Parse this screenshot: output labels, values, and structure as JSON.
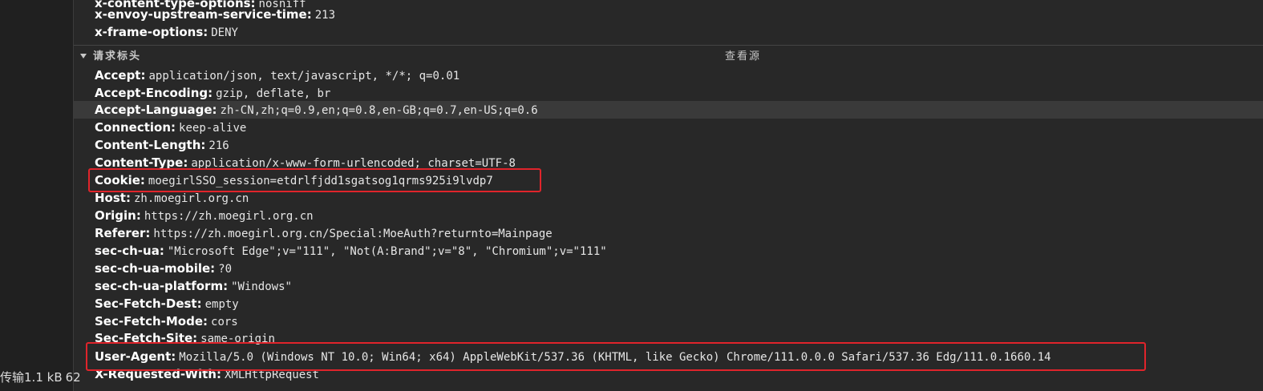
{
  "left_panel": {
    "status_label": "传输",
    "status_size": "1.1 kB",
    "status_trail": "62"
  },
  "response_headers_partial": [
    {
      "key": "x-content-type-options:",
      "value": "nosniff"
    },
    {
      "key": "x-envoy-upstream-service-time:",
      "value": "213"
    },
    {
      "key": "x-frame-options:",
      "value": "DENY"
    }
  ],
  "request_headers": {
    "title": "请求标头",
    "view_source": "查看源",
    "items": [
      {
        "key": "Accept:",
        "value": "application/json, text/javascript, */*; q=0.01"
      },
      {
        "key": "Accept-Encoding:",
        "value": "gzip, deflate, br"
      },
      {
        "key": "Accept-Language:",
        "value": "zh-CN,zh;q=0.9,en;q=0.8,en-GB;q=0.7,en-US;q=0.6"
      },
      {
        "key": "Connection:",
        "value": "keep-alive"
      },
      {
        "key": "Content-Length:",
        "value": "216"
      },
      {
        "key": "Content-Type:",
        "value": "application/x-www-form-urlencoded; charset=UTF-8"
      },
      {
        "key": "Cookie:",
        "value": "moegirlSSO_session=etdrlfjdd1sgatsog1qrms925i9lvdp7"
      },
      {
        "key": "Host:",
        "value": "zh.moegirl.org.cn"
      },
      {
        "key": "Origin:",
        "value": "https://zh.moegirl.org.cn"
      },
      {
        "key": "Referer:",
        "value": "https://zh.moegirl.org.cn/Special:MoeAuth?returnto=Mainpage"
      },
      {
        "key": "sec-ch-ua:",
        "value": "\"Microsoft Edge\";v=\"111\", \"Not(A:Brand\";v=\"8\", \"Chromium\";v=\"111\""
      },
      {
        "key": "sec-ch-ua-mobile:",
        "value": "?0"
      },
      {
        "key": "sec-ch-ua-platform:",
        "value": "\"Windows\""
      },
      {
        "key": "Sec-Fetch-Dest:",
        "value": "empty"
      },
      {
        "key": "Sec-Fetch-Mode:",
        "value": "cors"
      },
      {
        "key": "Sec-Fetch-Site:",
        "value": "same-origin"
      },
      {
        "key": "User-Agent:",
        "value": "Mozilla/5.0 (Windows NT 10.0; Win64; x64) AppleWebKit/537.36 (KHTML, like Gecko) Chrome/111.0.0.0 Safari/537.36 Edg/111.0.1660.14"
      },
      {
        "key": "X-Requested-With:",
        "value": "XMLHttpRequest"
      }
    ]
  },
  "colors": {
    "background": "#282828",
    "annotation_red": "#e0242b",
    "selected_row": "#3a3a3a"
  }
}
